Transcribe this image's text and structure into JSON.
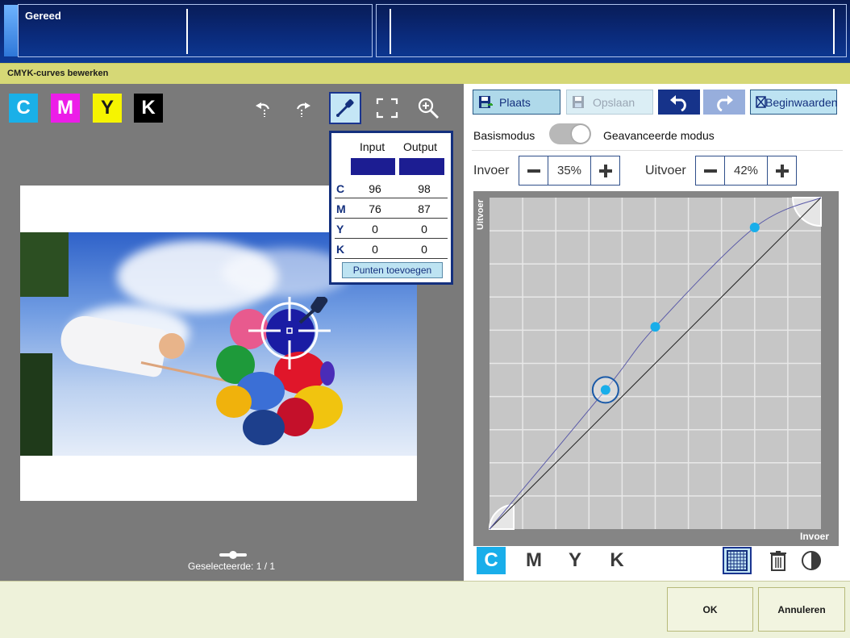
{
  "status": {
    "text": "Gereed"
  },
  "dialog": {
    "title": "CMYK-curves bewerken"
  },
  "preview": {
    "channels": [
      "C",
      "M",
      "Y",
      "K"
    ],
    "tools": [
      "rotate-left-icon",
      "rotate-right-icon",
      "eyedropper-icon",
      "fit-screen-icon",
      "zoom-in-icon"
    ],
    "selection_label": "Geselecteerde: 1 / 1"
  },
  "picker": {
    "input_header": "Input",
    "output_header": "Output",
    "swatch_color": "#1c1d92",
    "rows": [
      {
        "label": "C",
        "input": "96",
        "output": "98"
      },
      {
        "label": "M",
        "input": "76",
        "output": "87"
      },
      {
        "label": "Y",
        "input": "0",
        "output": "0"
      },
      {
        "label": "K",
        "input": "0",
        "output": "0"
      }
    ],
    "add_points": "Punten toevoegen"
  },
  "editor": {
    "save_place": "Plaats",
    "save": "Opslaan",
    "reset": "Beginwaarden",
    "mode_basic": "Basismodus",
    "mode_advanced": "Geavanceerde modus",
    "input_label": "Invoer",
    "input_value": "35%",
    "output_label": "Uitvoer",
    "output_value": "42%",
    "axis_y": "Uitvoer",
    "axis_x": "Invoer",
    "curve_points": [
      {
        "input": 35,
        "output": 42
      },
      {
        "input": 50,
        "output": 61
      },
      {
        "input": 80,
        "output": 91
      }
    ],
    "selected_point": {
      "input": 35,
      "output": 42
    },
    "active_channel": "C",
    "channels": [
      "C",
      "M",
      "Y",
      "K"
    ],
    "accent_color": "#19aeea"
  },
  "footer": {
    "ok": "OK",
    "cancel": "Annuleren"
  }
}
